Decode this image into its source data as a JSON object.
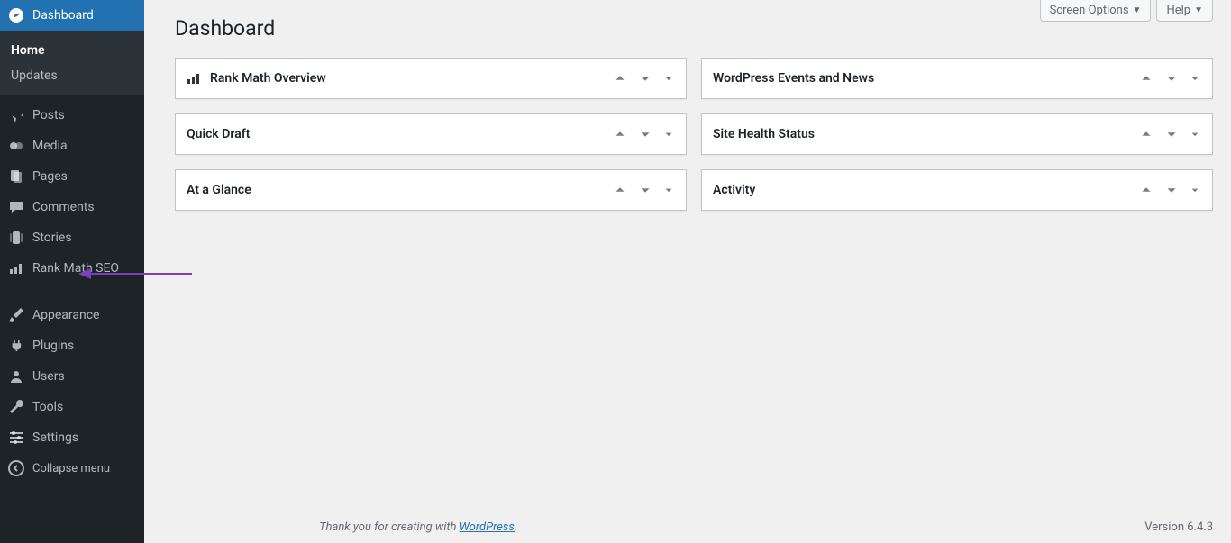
{
  "sidebar": {
    "dashboard_label": "Dashboard",
    "submenu": {
      "home": "Home",
      "updates": "Updates"
    },
    "items": [
      {
        "label": "Posts"
      },
      {
        "label": "Media"
      },
      {
        "label": "Pages"
      },
      {
        "label": "Comments"
      },
      {
        "label": "Stories"
      },
      {
        "label": "Rank Math SEO"
      }
    ],
    "items2": [
      {
        "label": "Appearance"
      },
      {
        "label": "Plugins"
      },
      {
        "label": "Users"
      },
      {
        "label": "Tools"
      },
      {
        "label": "Settings"
      }
    ],
    "collapse": "Collapse menu"
  },
  "header": {
    "screen_options": "Screen Options",
    "help": "Help"
  },
  "page_title": "Dashboard",
  "boxes_left": [
    {
      "title": "Rank Math Overview",
      "has_icon": true
    },
    {
      "title": "Quick Draft",
      "has_icon": false
    },
    {
      "title": "At a Glance",
      "has_icon": false
    }
  ],
  "boxes_right": [
    {
      "title": "WordPress Events and News"
    },
    {
      "title": "Site Health Status"
    },
    {
      "title": "Activity"
    }
  ],
  "footer": {
    "thanks_prefix": "Thank you for creating with ",
    "thanks_link": "WordPress",
    "thanks_suffix": ".",
    "version": "Version 6.4.3"
  }
}
